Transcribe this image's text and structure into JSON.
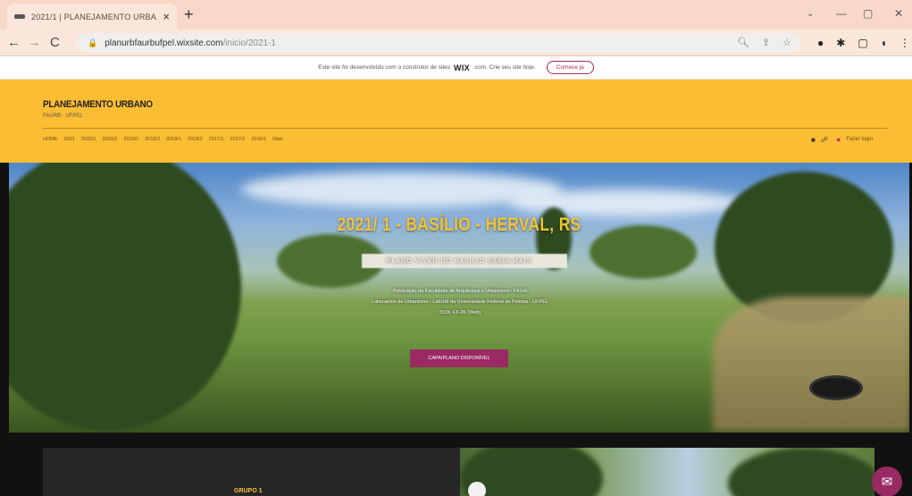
{
  "browser": {
    "tab_title": "2021/1 | PLANEJAMENTO URBA...",
    "tab_close": "×",
    "new_tab": "+",
    "back": "←",
    "forward": "→",
    "reload": "C",
    "url_host": "planurbfaurbufpel.wixsite.com",
    "url_path": "/inicio/2021-1",
    "window_controls": {
      "chevron": "⌄",
      "minimize": "—",
      "maximize": "▢",
      "close": "✕"
    }
  },
  "wix_banner": {
    "text": "Este site foi desenvolvido com o construtor de sites",
    "brand": "WIX",
    "text2": ".com. Crie seu site hoje.",
    "button": "Comece já"
  },
  "header": {
    "title": "PLANEJAMENTO URBANO",
    "subtitle": "FAURB · UFPEL",
    "menu": [
      "HOME",
      "2021",
      "2020/1",
      "2020/2",
      "2019/1",
      "2019/2",
      "2018/1",
      "2018/2",
      "2017/1",
      "2017/2",
      "2016/1",
      "Mais"
    ],
    "login": "Fazer login"
  },
  "hero": {
    "title": "2021/ 1 -  BASÍLIO - HERVAL, RS",
    "subtitle": "PLANO VIVER DO BASÍLIO SABIA MAIS",
    "desc_line1": "Publicação da Faculdade de Arquitetura e Urbanismo - FAUrb",
    "desc_line2": "Laboratório de Urbanismo - LabUrb da Universidade Federal de Pelotas - UFPEL",
    "desc_line3": "ISSN XX-2K (Web)",
    "button": "CAPA/PLANO DISPONÍVEL"
  },
  "section": {
    "group_label": "GRUPO 1"
  },
  "colors": {
    "header_bg": "#fbbd33",
    "accent": "#9a2a64",
    "title_yellow": "#f5c430"
  },
  "icons": {
    "lock": "lock-icon",
    "chat": "chat-icon"
  }
}
